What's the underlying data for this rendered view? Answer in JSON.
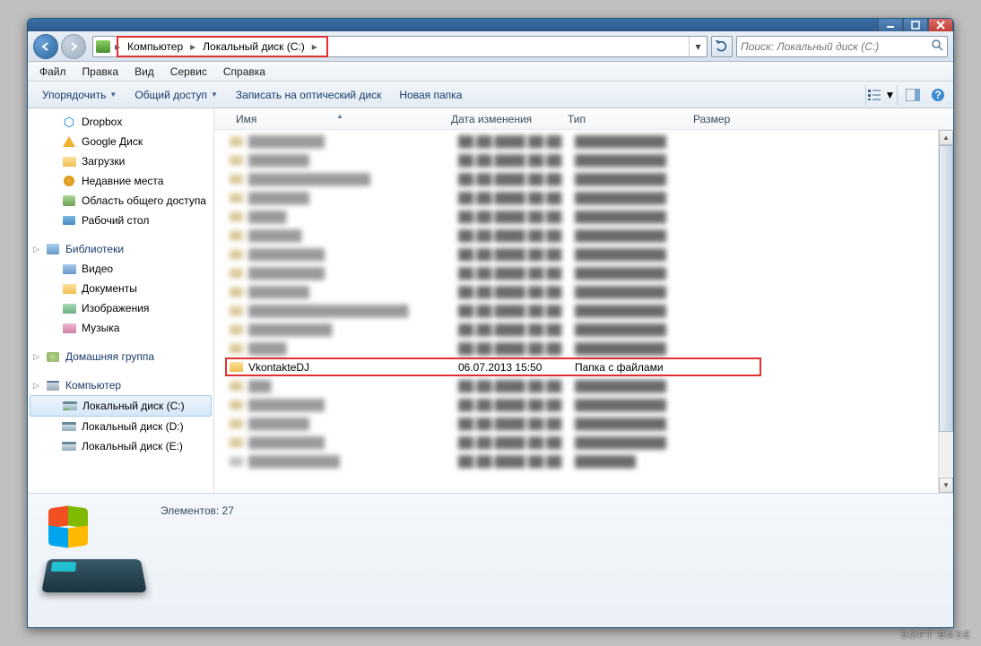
{
  "breadcrumb": {
    "root": "Компьютер",
    "drive": "Локальный диск (C:)"
  },
  "search": {
    "placeholder": "Поиск: Локальный диск (C:)"
  },
  "menu": {
    "file": "Файл",
    "edit": "Правка",
    "view": "Вид",
    "service": "Сервис",
    "help": "Справка"
  },
  "toolbar": {
    "organize": "Упорядочить",
    "share": "Общий доступ",
    "burn": "Записать на оптический диск",
    "newfolder": "Новая папка"
  },
  "columns": {
    "name": "Имя",
    "date": "Дата изменения",
    "type": "Тип",
    "size": "Размер"
  },
  "sidebar": {
    "fav": [
      "Dropbox",
      "Google Диск",
      "Загрузки",
      "Недавние места",
      "Область общего доступа",
      "Рабочий стол"
    ],
    "lib_head": "Библиотеки",
    "lib": [
      "Видео",
      "Документы",
      "Изображения",
      "Музыка"
    ],
    "homegroup": "Домашняя группа",
    "comp_head": "Компьютер",
    "drives": [
      "Локальный диск (C:)",
      "Локальный диск (D:)",
      "Локальный диск (E:)"
    ]
  },
  "highlight_row": {
    "name": "VkontakteDJ",
    "date": "06.07.2013 15:50",
    "type": "Папка с файлами"
  },
  "status": {
    "items": "Элементов: 27"
  },
  "watermark": "SOFT  BASE"
}
